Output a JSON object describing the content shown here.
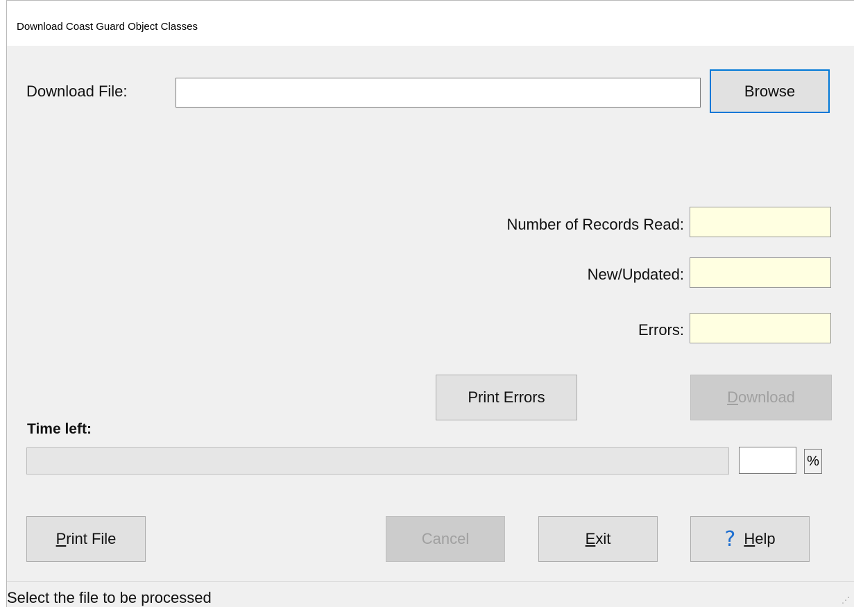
{
  "window": {
    "title": "Download Coast Guard Object Classes"
  },
  "download_file": {
    "label": "Download File:",
    "value": "",
    "browse_label": "Browse"
  },
  "stats": {
    "records_read_label": "Number of Records Read:",
    "records_read_value": "",
    "new_updated_label": "New/Updated:",
    "new_updated_value": "",
    "errors_label": "Errors:",
    "errors_value": ""
  },
  "actions": {
    "print_errors_label": "Print Errors",
    "download_label": "Download",
    "download_mnemonic": "D",
    "download_rest": "ownload"
  },
  "progress": {
    "label": "Time left:",
    "percent_value": "",
    "percent_sign": "%",
    "fraction": 0
  },
  "footer": {
    "print_file_mnemonic": "P",
    "print_file_rest": "rint File",
    "cancel_label": "Cancel",
    "exit_mnemonic": "E",
    "exit_rest": "xit",
    "help_icon": "?",
    "help_mnemonic": "H",
    "help_rest": "elp"
  },
  "status": {
    "text": "Select the file to be processed"
  },
  "colors": {
    "readonly_bg": "#ffffe1",
    "focus_border": "#0078d7",
    "help_icon": "#1e6fd0"
  }
}
